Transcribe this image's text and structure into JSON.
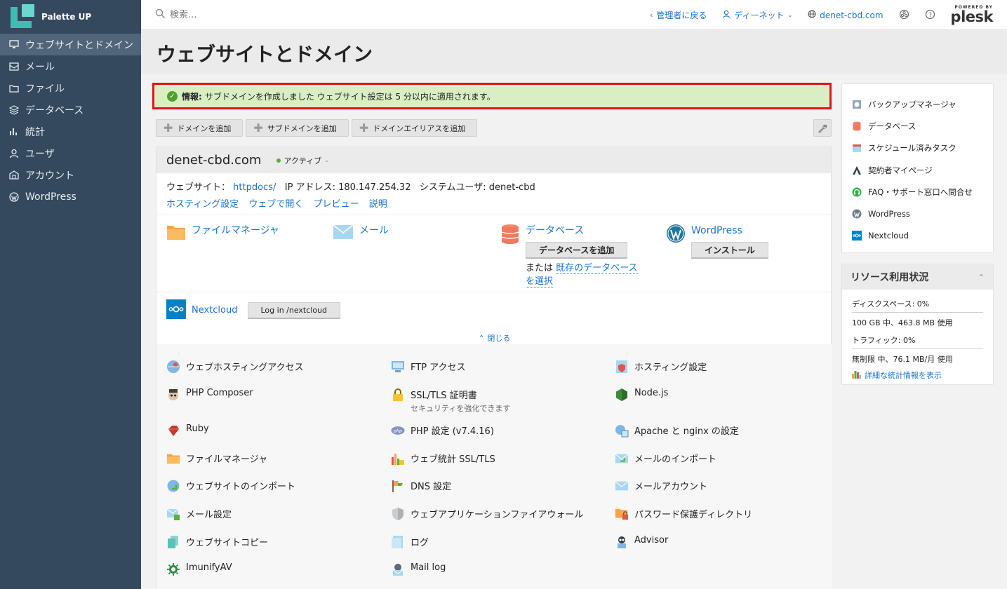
{
  "brand": {
    "name": "Palette UP"
  },
  "sidebar": {
    "items": [
      {
        "label": "ウェブサイトとドメイン",
        "icon": "monitor-icon",
        "active": true
      },
      {
        "label": "メール",
        "icon": "mail-icon"
      },
      {
        "label": "ファイル",
        "icon": "folder-icon"
      },
      {
        "label": "データベース",
        "icon": "database-icon"
      },
      {
        "label": "統計",
        "icon": "stats-icon"
      },
      {
        "label": "ユーザ",
        "icon": "user-icon"
      },
      {
        "label": "アカウント",
        "icon": "account-icon"
      },
      {
        "label": "WordPress",
        "icon": "wordpress-icon"
      }
    ]
  },
  "topbar": {
    "search_placeholder": "検索...",
    "back_to_admin": "管理者に戻る",
    "user_name": "ディーネット",
    "domain": "denet-cbd.com",
    "powered_by": "POWERED BY",
    "plesk": "plesk"
  },
  "page": {
    "title": "ウェブサイトとドメイン"
  },
  "notice": {
    "label": "情報:",
    "text": "サブドメインを作成しました ウェブサイト設定は 5 分以内に適用されます。"
  },
  "toolbar": {
    "add_domain": "ドメインを追加",
    "add_subdomain": "サブドメインを追加",
    "add_alias": "ドメインエイリアスを追加"
  },
  "domain": {
    "name": "denet-cbd.com",
    "status": "アクティブ",
    "website_label": "ウェブサイト：",
    "website_path": "httpdocs/",
    "ip_label": "IP アドレス:",
    "ip": "180.147.254.32",
    "sysuser_label": "システムユーザ:",
    "sysuser": "denet-cbd",
    "links": [
      "ホスティング設定",
      "ウェブで開く",
      "プレビュー",
      "説明"
    ],
    "quick": {
      "file_manager": "ファイルマネージャ",
      "mail": "メール",
      "database": "データベース",
      "add_database": "データベースを追加",
      "or_text": "または",
      "select_existing": "既存のデータベース",
      "select_existing_2": "を選択",
      "wordpress": "WordPress",
      "install": "インストール"
    },
    "nextcloud": "Nextcloud",
    "nextcloud_login": "Log in /nextcloud",
    "close_toggle": "閉じる"
  },
  "tools": {
    "col1": [
      "ウェブホスティングアクセス",
      "PHP Composer",
      "Ruby",
      "ファイルマネージャ",
      "ウェブサイトのインポート",
      "メール設定",
      "ウェブサイトコピー",
      "ImunifyAV"
    ],
    "col2": [
      "FTP アクセス",
      "SSL/TLS 証明書",
      "PHP 設定 (v7.4.16)",
      "ウェブ統計 SSL/TLS",
      "DNS 設定",
      "ウェブアプリケーションファイアウォール",
      "ログ",
      "Mail log"
    ],
    "col2_sub": "セキュリティを強化できます",
    "col3": [
      "ホスティング設定",
      "Node.js",
      "Apache と nginx の設定",
      "メールのインポート",
      "メールアカウント",
      "パスワード保護ディレクトリ",
      "Advisor"
    ]
  },
  "side_links": [
    "バックアップマネージャ",
    "データベース",
    "スケジュール済みタスク",
    "契約者マイページ",
    "FAQ・サポート窓口へ問合せ",
    "WordPress",
    "Nextcloud"
  ],
  "resources": {
    "title": "リソース利用状況",
    "disk_label": "ディスクスペース: 0%",
    "disk_detail": "100 GB 中、463.8 MB 使用",
    "traffic_label": "トラフィック: 0%",
    "traffic_detail": "無制限 中、76.1 MB/月 使用",
    "stats_link": "詳細な統計情報を表示"
  },
  "colors": {
    "sidebar_bg": "#34495e",
    "link": "#1a74c9",
    "notice_bg": "#d9efc3",
    "highlight_border": "#e1141b"
  }
}
